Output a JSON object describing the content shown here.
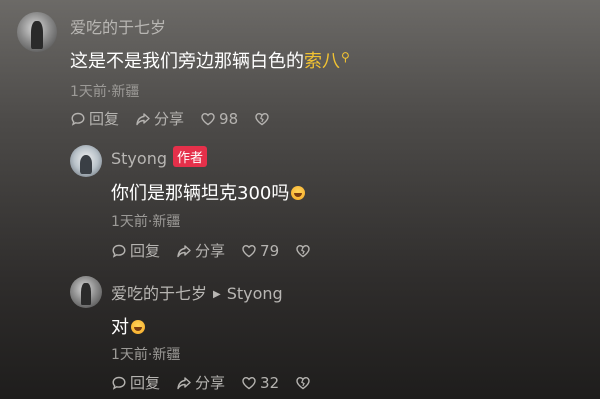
{
  "comments": [
    {
      "username": "爱吃的于七岁",
      "text": "这是不是我们旁边那辆白色的",
      "keyword": "索八",
      "meta": "1天前·新疆",
      "reply_label": "回复",
      "share_label": "分享",
      "likes": "98"
    },
    {
      "username": "Styong",
      "badge": "作者",
      "text": "你们是那辆坦克300吗",
      "meta": "1天前·新疆",
      "reply_label": "回复",
      "share_label": "分享",
      "likes": "79"
    },
    {
      "username": "爱吃的于七岁",
      "reply_to": "Styong",
      "text": "对",
      "meta": "1天前·新疆",
      "reply_label": "回复",
      "share_label": "分享",
      "likes": "32"
    }
  ],
  "icons": {
    "reply": "reply-icon",
    "share": "share-icon",
    "like": "heart-icon",
    "dislike": "broken-heart-icon",
    "emoji": "laughing-emoji-icon",
    "search": "search-icon"
  },
  "colors": {
    "keyword": "#f1c232",
    "author_badge": "#e5304a"
  }
}
